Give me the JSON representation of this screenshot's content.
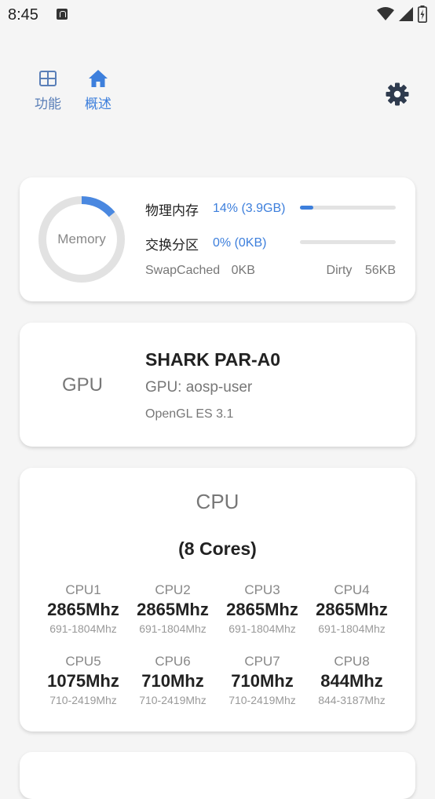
{
  "status_bar": {
    "time": "8:45"
  },
  "tabs": [
    {
      "label": "功能",
      "icon": "grid-icon",
      "active": false
    },
    {
      "label": "概述",
      "icon": "home-icon",
      "active": true
    }
  ],
  "settings_icon": "gear-icon",
  "colors": {
    "accent": "#3d7fdc",
    "background": "#f5f5f5",
    "card": "#ffffff"
  },
  "memory": {
    "donut_label": "Memory",
    "usage_fraction": 0.14,
    "physical_label": "物理内存",
    "physical_value": "14% (3.9GB)",
    "physical_fraction": 0.14,
    "swap_label": "交换分区",
    "swap_value": "0% (0KB)",
    "swap_fraction": 0,
    "swapcached_label": "SwapCached",
    "swapcached_value": "0KB",
    "dirty_label": "Dirty",
    "dirty_value": "56KB"
  },
  "gpu": {
    "title": "GPU",
    "name": "SHARK PAR-A0",
    "renderer": "GPU: aosp-user",
    "gl_version": "OpenGL ES 3.1"
  },
  "cpu": {
    "title": "CPU",
    "cores_label": "(8 Cores)",
    "cores": [
      {
        "name": "CPU1",
        "freq": "2865Mhz",
        "range": "691-1804Mhz"
      },
      {
        "name": "CPU2",
        "freq": "2865Mhz",
        "range": "691-1804Mhz"
      },
      {
        "name": "CPU3",
        "freq": "2865Mhz",
        "range": "691-1804Mhz"
      },
      {
        "name": "CPU4",
        "freq": "2865Mhz",
        "range": "691-1804Mhz"
      },
      {
        "name": "CPU5",
        "freq": "1075Mhz",
        "range": "710-2419Mhz"
      },
      {
        "name": "CPU6",
        "freq": "710Mhz",
        "range": "710-2419Mhz"
      },
      {
        "name": "CPU7",
        "freq": "710Mhz",
        "range": "710-2419Mhz"
      },
      {
        "name": "CPU8",
        "freq": "844Mhz",
        "range": "844-3187Mhz"
      }
    ]
  }
}
